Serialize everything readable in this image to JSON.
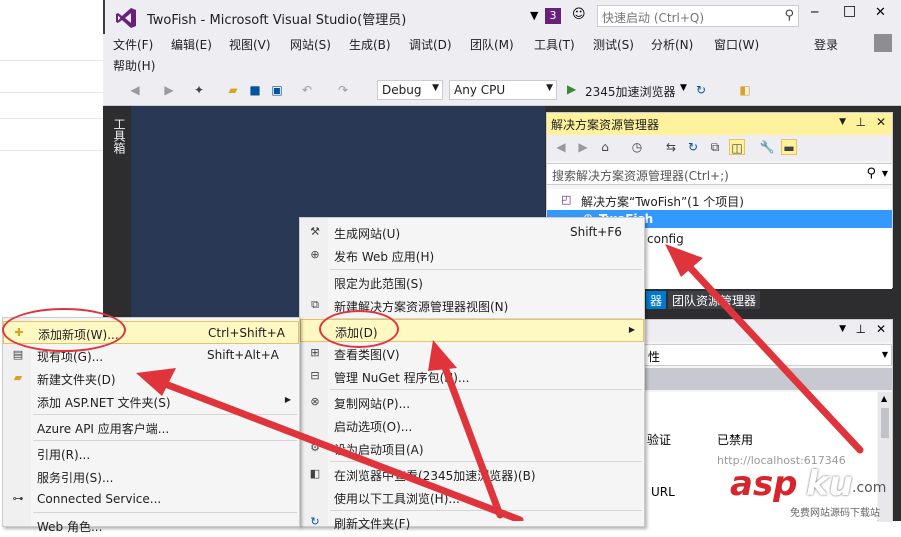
{
  "window": {
    "title": "TwoFish - Microsoft Visual Studio(管理员)",
    "notifications": "3",
    "quick_launch_placeholder": "快速启动 (Ctrl+Q)",
    "minimize": "─",
    "maximize": "□",
    "close": "✕"
  },
  "menubar": {
    "items": [
      "文件(F)",
      "编辑(E)",
      "视图(V)",
      "网站(S)",
      "生成(B)",
      "调试(D)",
      "团队(M)",
      "工具(T)",
      "测试(S)",
      "分析(N)",
      "窗口(W)",
      "帮助(H)"
    ],
    "signin": "登录"
  },
  "toolbar": {
    "config": "Debug",
    "platform": "Any CPU",
    "run_target": "2345加速浏览器"
  },
  "toolbox_tab": "工具箱",
  "solution_explorer": {
    "title": "解决方案资源管理器",
    "search_placeholder": "搜索解决方案资源管理器(Ctrl+;)",
    "solution_label": "解决方案“TwoFish”(1 个项目)",
    "project": "TwoFish",
    "file_partial": "config"
  },
  "tabs": {
    "tab1": "器",
    "tab2": "团队资源管理器"
  },
  "properties": {
    "header_partial": "性",
    "auth_label": "验证",
    "auth_value": "已禁用",
    "url_label": "URL",
    "url_partial": "http://localhost:617346"
  },
  "context_menu_main": {
    "items": [
      {
        "label": "生成网站(U)",
        "shortcut": "Shift+F6",
        "icon": "build-icon"
      },
      {
        "label": "发布 Web 应用(H)",
        "shortcut": "",
        "icon": "globe-icon"
      },
      {
        "label": "限定为此范围(S)",
        "shortcut": "",
        "icon": ""
      },
      {
        "label": "新建解决方案资源管理器视图(N)",
        "shortcut": "",
        "icon": "window-icon"
      },
      {
        "label": "添加(D)",
        "shortcut": "",
        "icon": ""
      },
      {
        "label": "查看类图(V)",
        "shortcut": "",
        "icon": "class-diagram-icon"
      },
      {
        "label": "管理 NuGet 程序包(N)...",
        "shortcut": "",
        "icon": "package-icon"
      },
      {
        "label": "复制网站(P)...",
        "shortcut": "",
        "icon": "copy-web-icon"
      },
      {
        "label": "启动选项(O)...",
        "shortcut": "",
        "icon": ""
      },
      {
        "label": "设为启动项目(A)",
        "shortcut": "",
        "icon": "gear-icon"
      },
      {
        "label": "在浏览器中查看(2345加速浏览器)(B)",
        "shortcut": "",
        "icon": "browser-icon"
      },
      {
        "label": "使用以下工具浏览(H)...",
        "shortcut": "",
        "icon": ""
      },
      {
        "label": "刷新文件夹(F)",
        "shortcut": "",
        "icon": "refresh-icon"
      }
    ]
  },
  "context_menu_add": {
    "items": [
      {
        "label": "添加新项(W)...",
        "shortcut": "Ctrl+Shift+A",
        "icon": "new-item-icon"
      },
      {
        "label": "现有项(G)...",
        "shortcut": "Shift+Alt+A",
        "icon": "existing-item-icon"
      },
      {
        "label": "新建文件夹(D)",
        "shortcut": "",
        "icon": "folder-icon"
      },
      {
        "label": "添加 ASP.NET 文件夹(S)",
        "shortcut": "",
        "icon": ""
      },
      {
        "label": "Azure API 应用客户端...",
        "shortcut": "",
        "icon": ""
      },
      {
        "label": "引用(R)...",
        "shortcut": "",
        "icon": ""
      },
      {
        "label": "服务引用(S)...",
        "shortcut": "",
        "icon": ""
      },
      {
        "label": "Connected Service...",
        "shortcut": "",
        "icon": "connected-service-icon"
      },
      {
        "label": "Web 角色...",
        "shortcut": "",
        "icon": ""
      }
    ]
  },
  "watermark": {
    "brand_a": "asp",
    "brand_b": "ku",
    "brand_c": ".com",
    "sub": "免费网站源码下载站"
  },
  "colors": {
    "highlight": "#fef9c3",
    "annotation_red": "#e0343d",
    "panel_title": "#fff29d",
    "vs_purple": "#68217a",
    "selection": "#3399ff"
  }
}
